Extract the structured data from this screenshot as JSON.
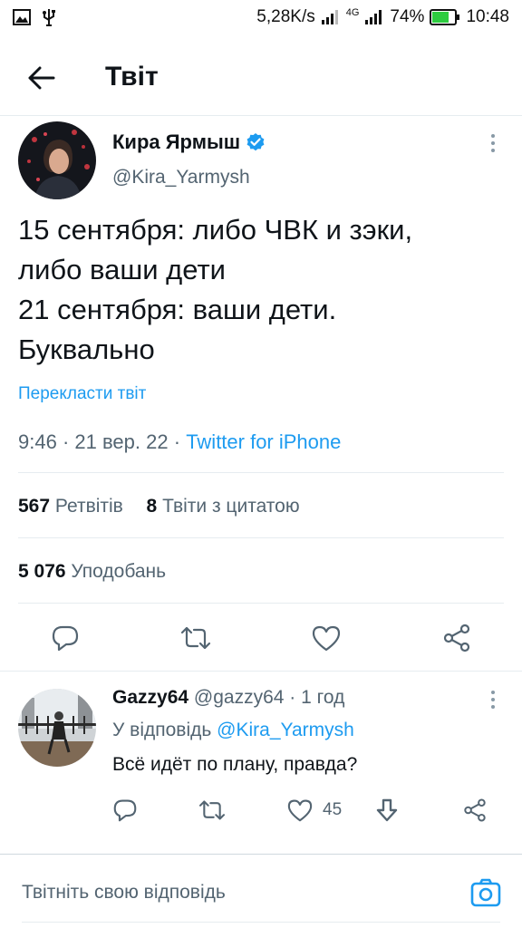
{
  "status_bar": {
    "network_speed": "5,28K/s",
    "network_type": "4G",
    "battery": "74%",
    "time": "10:48",
    "icons": [
      "image-icon",
      "usb-icon",
      "signal-icon",
      "battery-icon"
    ]
  },
  "header": {
    "title": "Твіт",
    "back_icon": "arrow-left-icon"
  },
  "tweet": {
    "author_name": "Кира Ярмыш",
    "author_handle": "@Kira_Yarmysh",
    "verified": true,
    "text_lines": [
      "15 сентября: либо ЧВК и зэки,",
      "либо ваши дети",
      "21 сентября: ваши дети.",
      "Буквально"
    ],
    "translate_label": "Перекласти твіт",
    "time": "9:46",
    "date": "21 вер. 22",
    "separator": "·",
    "source": "Twitter for iPhone",
    "retweets_count": "567",
    "retweets_label": "Ретвітів",
    "quotes_count": "8",
    "quotes_label": "Твіти з цитатою",
    "likes_count": "5 076",
    "likes_label": "Уподобань"
  },
  "reply": {
    "author_name": "Gazzy64",
    "author_handle": "@gazzy64",
    "time_ago": "1 год",
    "reply_to_label": "У відповідь",
    "reply_to_handle": "@Kira_Yarmysh",
    "text": "Всё идёт по плану, правда?",
    "like_count": "45"
  },
  "compose": {
    "placeholder": "Твітніть свою відповідь"
  },
  "colors": {
    "accent": "#1d9bf0",
    "text_primary": "#0f1419",
    "text_secondary": "#536471",
    "divider": "#e6ecf0",
    "battery_fill": "#2ecc40"
  }
}
